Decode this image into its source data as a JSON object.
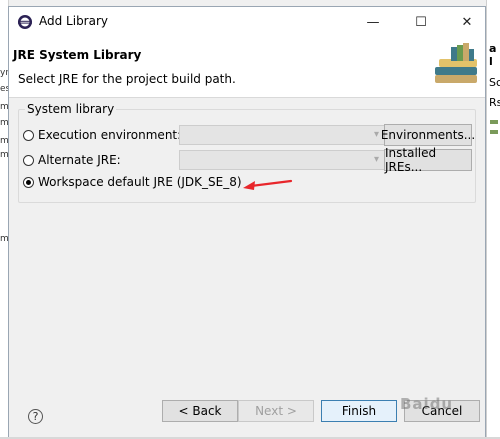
{
  "window": {
    "title": "Add Library",
    "minimize_glyph": "—",
    "maximize_glyph": "☐",
    "close_glyph": "✕"
  },
  "header": {
    "title": "JRE System Library",
    "subtitle": "Select JRE for the project build path."
  },
  "group": {
    "legend": "System library",
    "options": [
      {
        "label": "Execution environment:",
        "selected": false,
        "button": "Environments..."
      },
      {
        "label": "Alternate JRE:",
        "selected": false,
        "button": "Installed JREs..."
      },
      {
        "label": "Workspace default JRE (JDK_SE_8)",
        "selected": true
      }
    ]
  },
  "footer": {
    "help": "?",
    "back": "< Back",
    "next": "Next >",
    "finish": "Finish",
    "cancel": "Cancel"
  },
  "background": {
    "right_title": "a l",
    "right_line1": "Sc",
    "right_line2": "Rs"
  },
  "watermark": "Baidu",
  "colors": {
    "annotation_arrow": "#e8262b",
    "accent_border": "#3c7fb1"
  }
}
